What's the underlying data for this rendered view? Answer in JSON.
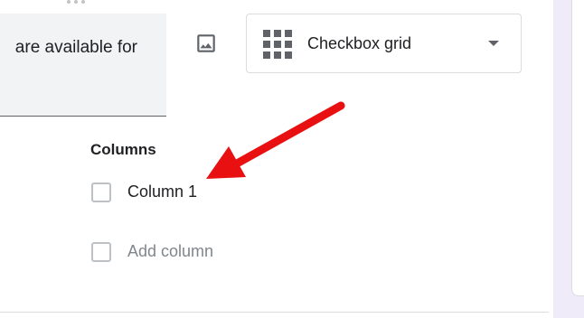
{
  "question": {
    "text_fragment": "are available for"
  },
  "toolbar": {
    "image_icon": "image-icon"
  },
  "type_select": {
    "icon": "grid-icon",
    "label": "Checkbox grid",
    "caret_icon": "dropdown-caret-icon"
  },
  "columns": {
    "title": "Columns",
    "items": [
      {
        "label": "Column 1"
      }
    ],
    "add_label": "Add column"
  },
  "annotation": {
    "arrow_color": "#e81010"
  },
  "colors": {
    "panel_background": "#f0ebf8",
    "field_background": "#f1f3f4"
  }
}
